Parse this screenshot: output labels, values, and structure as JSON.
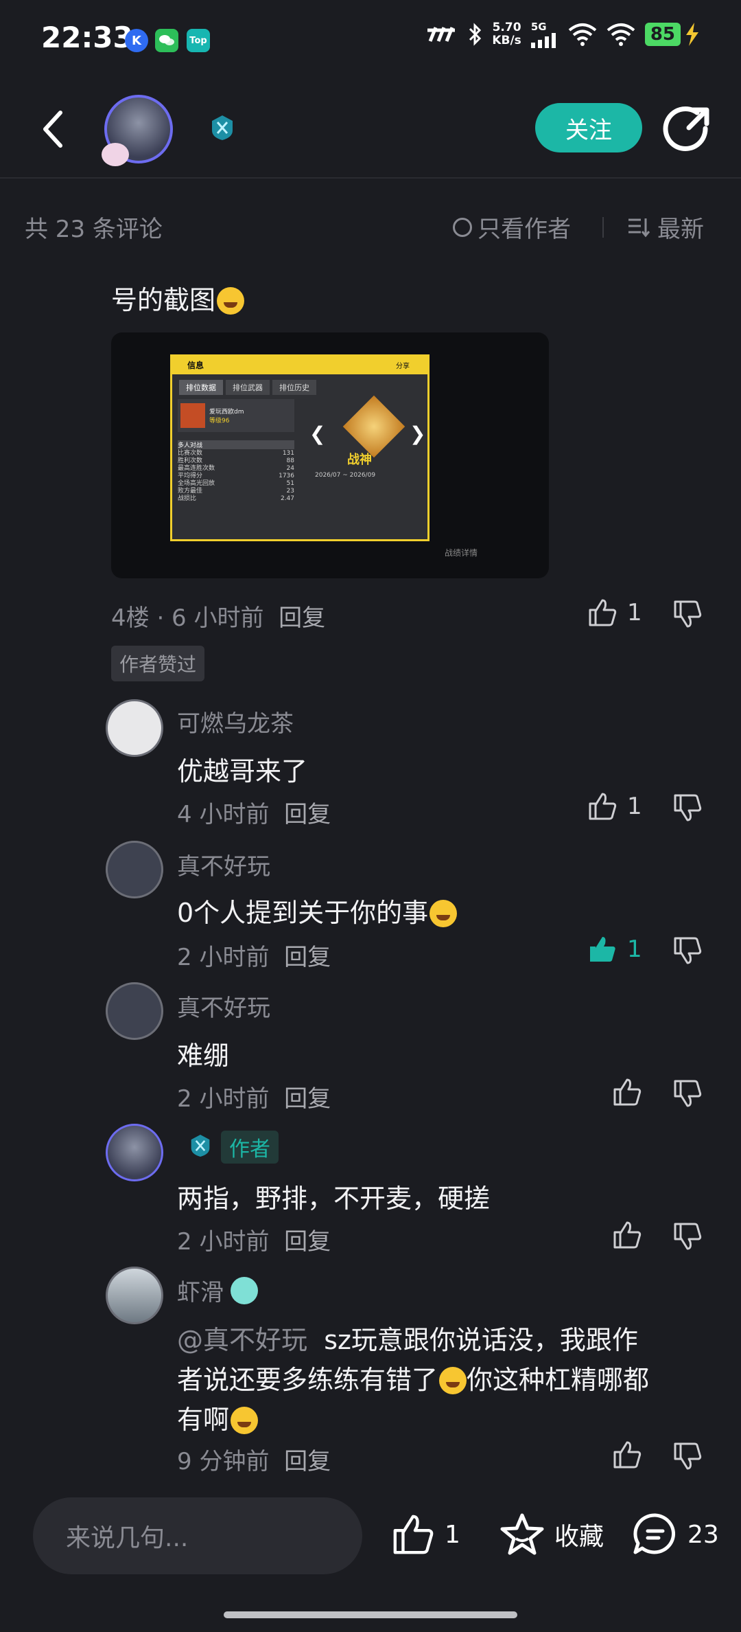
{
  "status_bar": {
    "time": "22:33",
    "apps": [
      "K",
      "W",
      "Top"
    ],
    "net_speed": "5.70",
    "net_unit": "KB/s",
    "network": "5G",
    "battery": "85"
  },
  "header": {
    "follow_label": "关注"
  },
  "comments_header": {
    "count_label": "共 23 条评论",
    "only_author_label": "只看作者",
    "sort_label": "最新"
  },
  "post": {
    "text": "号的截图",
    "screenshot": {
      "title": "信息",
      "share": "分享",
      "tabs": [
        "排位数据",
        "排位武器",
        "排位历史"
      ],
      "player_name": "爱玩西欧dm",
      "player_level": "等级96",
      "section": "多人对战",
      "stats": [
        {
          "label": "比赛次数",
          "value": "131"
        },
        {
          "label": "胜利次数",
          "value": "88"
        },
        {
          "label": "最高连胜次数",
          "value": "24"
        },
        {
          "label": "平均得分",
          "value": "1736"
        },
        {
          "label": "全场高光回放",
          "value": "51"
        },
        {
          "label": "败方最佳",
          "value": "23"
        },
        {
          "label": "战损比",
          "value": "2.47"
        }
      ],
      "rank": "战神",
      "season": "2026/07 ~ 2026/09",
      "details_btn": "战绩详情"
    },
    "meta": "4楼 · 6 小时前",
    "reply": "回复",
    "likes": "1",
    "author_liked_badge": "作者赞过"
  },
  "replies": [
    {
      "name": "可燃乌龙茶",
      "text": "优越哥来了",
      "time": "4 小时前",
      "reply": "回复",
      "likes": "1"
    },
    {
      "name": "真不好玩",
      "text": "0个人提到关于你的事",
      "time": "2 小时前",
      "reply": "回复",
      "likes": "1"
    },
    {
      "name": "真不好玩",
      "text": "难绷",
      "time": "2 小时前",
      "reply": "回复",
      "likes": ""
    },
    {
      "name": "",
      "author_tag": "作者",
      "text": "两指，野排，不开麦，硬搓",
      "time": "2 小时前",
      "reply": "回复",
      "likes": ""
    },
    {
      "name": "虾滑",
      "mention": "@真不好玩",
      "text1": "sz玩意跟你说话没，我跟作",
      "text2": "者说还要多练练有错了",
      "text2b": "你这种杠精哪都",
      "text3": "有啊",
      "time": "9 分钟前",
      "reply": "回复",
      "likes": ""
    }
  ],
  "bottom_bar": {
    "input_placeholder": "来说几句...",
    "likes": "1",
    "favorite_label": "收藏",
    "comments": "23"
  },
  "colors": {
    "background": "#1b1c21",
    "accent": "#1cb7a6",
    "muted_text": "#8a8b93"
  }
}
